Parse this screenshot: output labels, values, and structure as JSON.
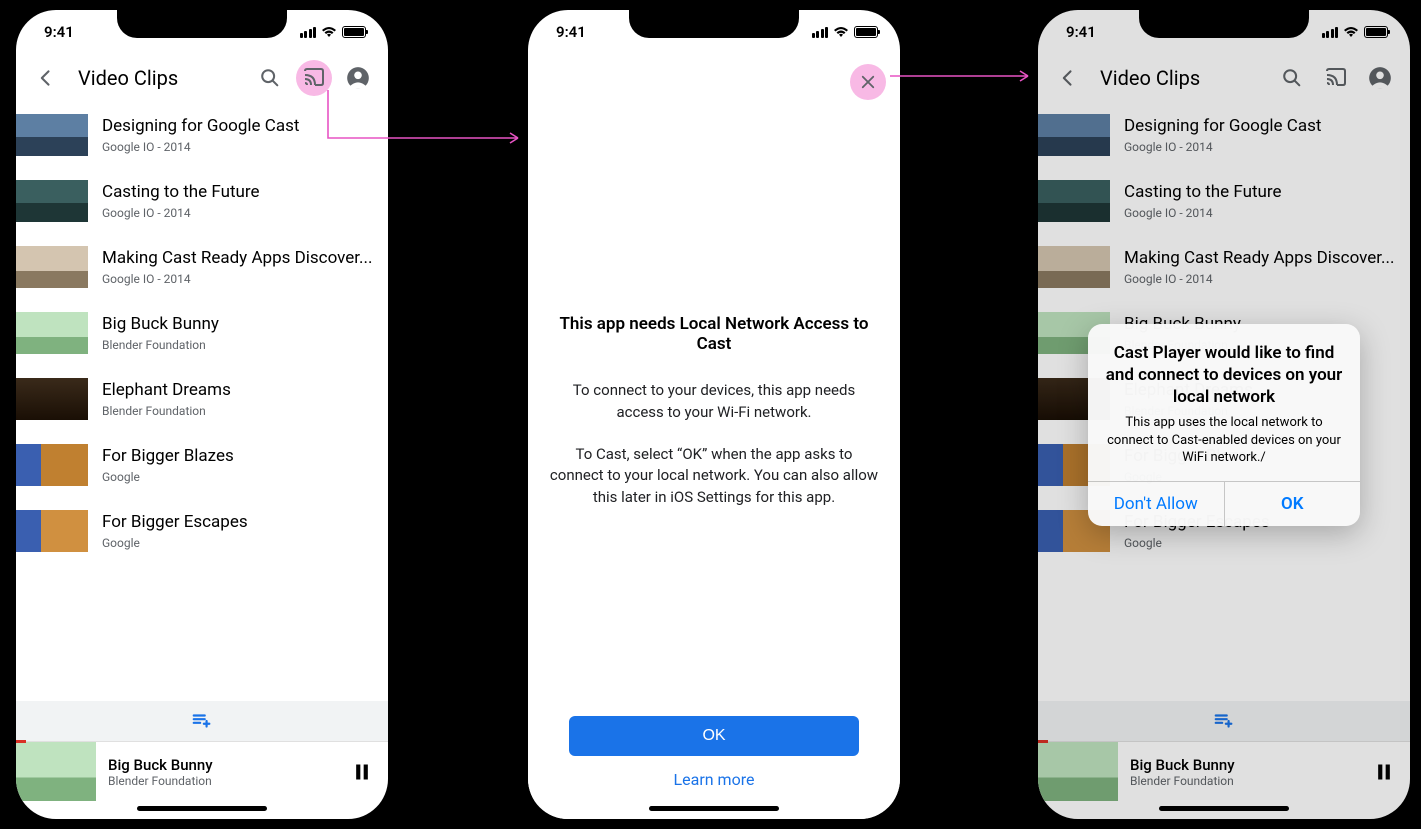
{
  "status": {
    "time": "9:41"
  },
  "toolbar": {
    "title": "Video Clips"
  },
  "videos": [
    {
      "title": "Designing for Google Cast",
      "subtitle": "Google IO - 2014"
    },
    {
      "title": "Casting to the Future",
      "subtitle": "Google IO - 2014"
    },
    {
      "title": "Making Cast Ready Apps Discover...",
      "subtitle": "Google IO - 2014"
    },
    {
      "title": "Big Buck Bunny",
      "subtitle": "Blender Foundation"
    },
    {
      "title": "Elephant Dreams",
      "subtitle": "Blender Foundation"
    },
    {
      "title": "For Bigger Blazes",
      "subtitle": "Google"
    },
    {
      "title": "For Bigger Escapes",
      "subtitle": "Google"
    }
  ],
  "now_playing": {
    "title": "Big Buck Bunny",
    "subtitle": "Blender Foundation"
  },
  "interstitial": {
    "heading": "This app needs Local Network Access to Cast",
    "body1": "To connect to your devices, this app needs access to your Wi-Fi network.",
    "body2": "To Cast, select “OK” when the app asks to connect to your local network. You can also allow this later in iOS Settings for this app.",
    "ok": "OK",
    "learn": "Learn more"
  },
  "ios_dialog": {
    "title": "Cast Player would like to find and connect to devices on your local network",
    "message": "This app uses the local network to connect to Cast-enabled devices on your WiFi network./",
    "deny": "Don't Allow",
    "allow": "OK"
  }
}
